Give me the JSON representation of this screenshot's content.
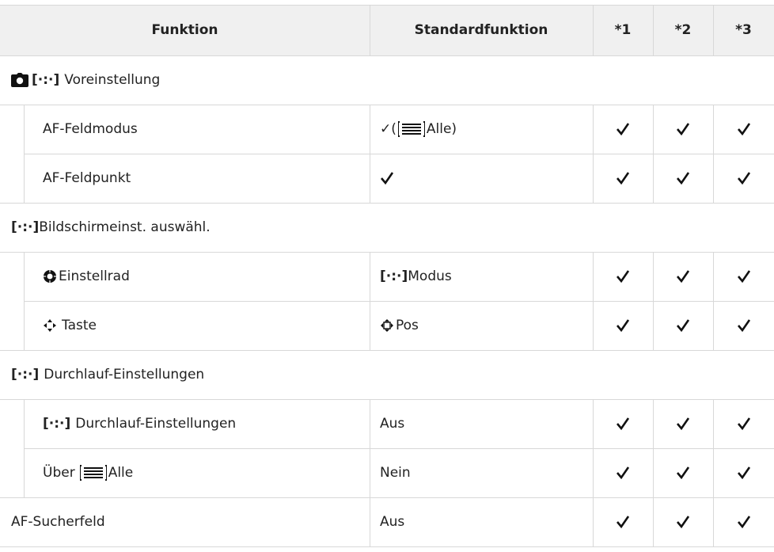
{
  "table": {
    "header": {
      "funktion": "Funktion",
      "standard": "Standardfunktion",
      "c1": "*1",
      "c2": "*2",
      "c3": "*3"
    },
    "af_symbol": "[·:·]",
    "group1": {
      "title": "Voreinstellung",
      "rows": [
        {
          "name": "AF-Feldmodus",
          "std_prefix": "✓(",
          "std_suffix": "Alle)"
        },
        {
          "name": "AF-Feldpunkt"
        }
      ]
    },
    "group2": {
      "title": "Bildschirmeinst. auswähl.",
      "rows": [
        {
          "name": "Einstellrad",
          "std": "Modus"
        },
        {
          "name": "Taste",
          "std": "Pos"
        }
      ]
    },
    "group3": {
      "title": "Durchlauf-Einstellungen",
      "rows": [
        {
          "name": "Durchlauf-Einstellungen",
          "std": "Aus"
        },
        {
          "name_prefix": "Über",
          "name_suffix": "Alle",
          "std": "Nein"
        }
      ]
    },
    "last_row": {
      "name": "AF-Sucherfeld",
      "std": "Aus"
    }
  },
  "colors": {
    "header_bg": "#f0f0f0",
    "grid": "#d8d8d8",
    "text": "#222222"
  },
  "icons": [
    "camera-icon",
    "af-target-icon",
    "dial-icon",
    "arrow-pad-icon",
    "all-targets-icon",
    "check-icon"
  ]
}
